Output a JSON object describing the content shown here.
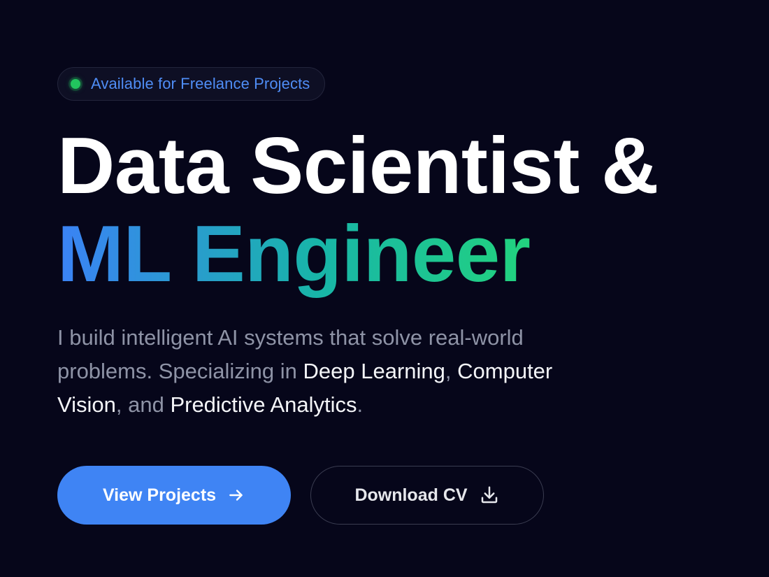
{
  "badge": {
    "text": "Available for Freelance Projects",
    "status_color": "#22c55e"
  },
  "headline": {
    "line1": "Data Scientist &",
    "line2": "ML Engineer",
    "gradient_colors": [
      "#3b82f6",
      "#18b5a8",
      "#22d37e"
    ]
  },
  "intro": {
    "part1": "I build intelligent AI systems that solve real-world problems. Specializing in ",
    "highlight1": "Deep Learning",
    "part2": ", ",
    "highlight2": "Computer Vision",
    "part3": ", and ",
    "highlight3": "Predictive Analytics",
    "part4": "."
  },
  "actions": {
    "primary": {
      "label": "View Projects",
      "icon": "arrow-right-icon"
    },
    "secondary": {
      "label": "Download CV",
      "icon": "download-icon"
    }
  },
  "colors": {
    "background": "#06061a",
    "accent": "#3f84f4",
    "muted_text": "#8e93a6"
  }
}
